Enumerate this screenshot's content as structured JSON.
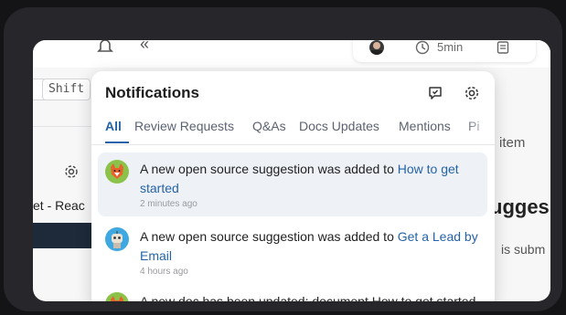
{
  "topbar": {
    "time_label": "5min"
  },
  "keys": {
    "k1": "",
    "k2": "Shift"
  },
  "left": {
    "text": "et - Reac"
  },
  "right": {
    "item": "item",
    "heading": "ugges",
    "sub": "is subm"
  },
  "panel": {
    "title": "Notifications",
    "tabs": [
      "All",
      "Review Requests",
      "Q&As",
      "Docs Updates",
      "Mentions",
      "Pi"
    ],
    "notifications": [
      {
        "text": "A new open source suggestion was added to ",
        "link": "How to get started",
        "time": "2 minutes ago",
        "avatar": "fox-avatar"
      },
      {
        "text": "A new open source suggestion was added to ",
        "link": "Get a Lead by Email",
        "time": "4 hours ago",
        "avatar": "robot-avatar"
      },
      {
        "text": "A new doc has been updated: document How to get started",
        "link": "",
        "time": "",
        "avatar": "fox-avatar"
      }
    ]
  },
  "colors": {
    "accent": "#2563a8",
    "highlight": "#eef2f7",
    "dark_bar": "#1e2a3a"
  }
}
